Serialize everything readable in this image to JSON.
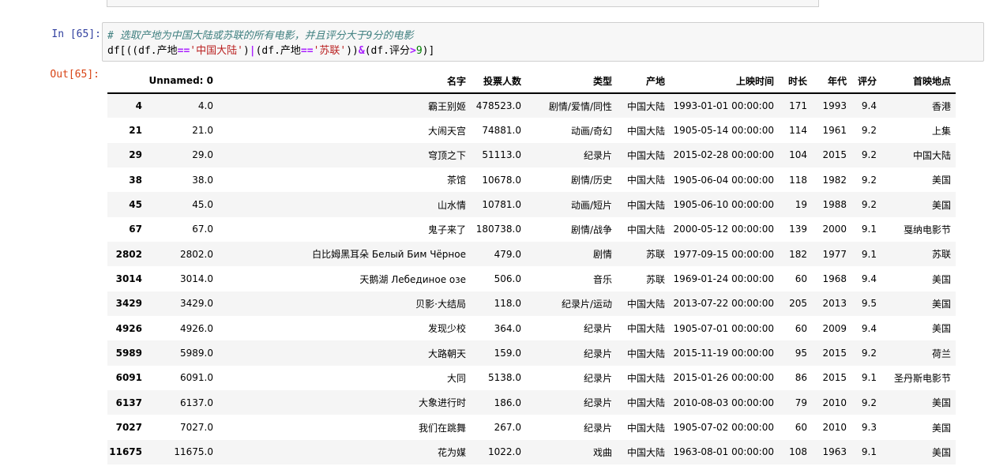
{
  "prev_cell": {},
  "input_cell": {
    "prompt": "In  [65]:",
    "comment": "# 选取产地为中国大陆或苏联的所有电影，并且评分大于9分的电影",
    "code_parts": {
      "p1": "df[((df.产地",
      "eq1": "==",
      "s1": "'中国大陆'",
      "p2": ")",
      "or": "|",
      "p3": "(df.产地",
      "eq2": "==",
      "s2": "'苏联'",
      "p4": "))",
      "and": "&",
      "p5": "(df.评分",
      "gt": ">",
      "n9": "9",
      "p6": ")]"
    }
  },
  "output_cell": {
    "prompt": "Out[65]:",
    "columns": [
      "Unnamed: 0",
      "名字",
      "投票人数",
      "类型",
      "产地",
      "上映时间",
      "时长",
      "年代",
      "评分",
      "首映地点"
    ],
    "rows": [
      {
        "idx": "4",
        "c": [
          "4.0",
          "霸王别姬",
          "478523.0",
          "剧情/爱情/同性",
          "中国大陆",
          "1993-01-01 00:00:00",
          "171",
          "1993",
          "9.4",
          "香港"
        ]
      },
      {
        "idx": "21",
        "c": [
          "21.0",
          "大闹天宫",
          "74881.0",
          "动画/奇幻",
          "中国大陆",
          "1905-05-14 00:00:00",
          "114",
          "1961",
          "9.2",
          "上集"
        ]
      },
      {
        "idx": "29",
        "c": [
          "29.0",
          "穹顶之下",
          "51113.0",
          "纪录片",
          "中国大陆",
          "2015-02-28 00:00:00",
          "104",
          "2015",
          "9.2",
          "中国大陆"
        ]
      },
      {
        "idx": "38",
        "c": [
          "38.0",
          "茶馆",
          "10678.0",
          "剧情/历史",
          "中国大陆",
          "1905-06-04 00:00:00",
          "118",
          "1982",
          "9.2",
          "美国"
        ]
      },
      {
        "idx": "45",
        "c": [
          "45.0",
          "山水情",
          "10781.0",
          "动画/短片",
          "中国大陆",
          "1905-06-10 00:00:00",
          "19",
          "1988",
          "9.2",
          "美国"
        ]
      },
      {
        "idx": "67",
        "c": [
          "67.0",
          "鬼子来了",
          "180738.0",
          "剧情/战争",
          "中国大陆",
          "2000-05-12 00:00:00",
          "139",
          "2000",
          "9.1",
          "戛纳电影节"
        ]
      },
      {
        "idx": "2802",
        "c": [
          "2802.0",
          "白比姆黑耳朵 Белый Бим Чёрное",
          "479.0",
          "剧情",
          "苏联",
          "1977-09-15 00:00:00",
          "182",
          "1977",
          "9.1",
          "苏联"
        ]
      },
      {
        "idx": "3014",
        "c": [
          "3014.0",
          "天鹅湖 Лебединое озе",
          "506.0",
          "音乐",
          "苏联",
          "1969-01-24 00:00:00",
          "60",
          "1968",
          "9.4",
          "美国"
        ]
      },
      {
        "idx": "3429",
        "c": [
          "3429.0",
          "贝影·大结局",
          "118.0",
          "纪录片/运动",
          "中国大陆",
          "2013-07-22 00:00:00",
          "205",
          "2013",
          "9.5",
          "美国"
        ]
      },
      {
        "idx": "4926",
        "c": [
          "4926.0",
          "发现少校",
          "364.0",
          "纪录片",
          "中国大陆",
          "1905-07-01 00:00:00",
          "60",
          "2009",
          "9.4",
          "美国"
        ]
      },
      {
        "idx": "5989",
        "c": [
          "5989.0",
          "大路朝天",
          "159.0",
          "纪录片",
          "中国大陆",
          "2015-11-19 00:00:00",
          "95",
          "2015",
          "9.2",
          "荷兰"
        ]
      },
      {
        "idx": "6091",
        "c": [
          "6091.0",
          "大同",
          "5138.0",
          "纪录片",
          "中国大陆",
          "2015-01-26 00:00:00",
          "86",
          "2015",
          "9.1",
          "圣丹斯电影节"
        ]
      },
      {
        "idx": "6137",
        "c": [
          "6137.0",
          "大象进行时",
          "186.0",
          "纪录片",
          "中国大陆",
          "2010-08-03 00:00:00",
          "79",
          "2010",
          "9.2",
          "美国"
        ]
      },
      {
        "idx": "7027",
        "c": [
          "7027.0",
          "我们在跳舞",
          "267.0",
          "纪录片",
          "中国大陆",
          "1905-07-02 00:00:00",
          "60",
          "2010",
          "9.3",
          "美国"
        ]
      },
      {
        "idx": "11675",
        "c": [
          "11675.0",
          "花为媒",
          "1022.0",
          "戏曲",
          "中国大陆",
          "1963-08-01 00:00:00",
          "108",
          "1963",
          "9.1",
          "美国"
        ]
      }
    ]
  },
  "colors": {
    "in_prompt": "#303f9f",
    "out_prompt": "#d84315",
    "comment": "#408080",
    "string": "#ba2121",
    "operator": "#aa22ff",
    "number": "#008000",
    "cell_bg": "#f7f7f7",
    "stripe": "#f5f5f5"
  }
}
